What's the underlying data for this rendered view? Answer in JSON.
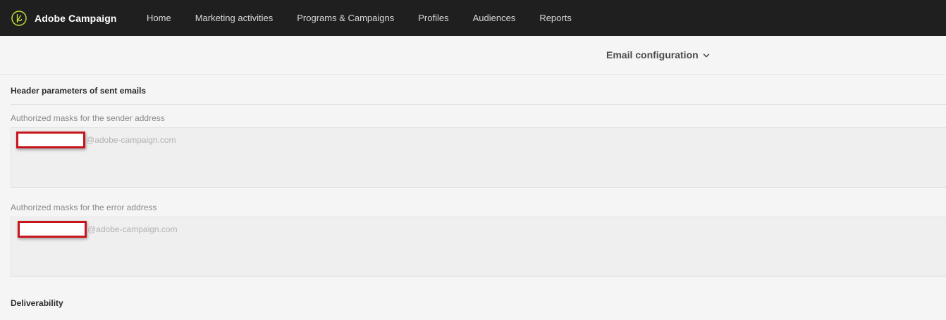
{
  "app": {
    "brand_name": "Adobe Campaign",
    "logo_icon": "adobe-campaign-logo-icon"
  },
  "nav": {
    "items": [
      {
        "label": "Home"
      },
      {
        "label": "Marketing activities"
      },
      {
        "label": "Programs & Campaigns"
      },
      {
        "label": "Profiles"
      },
      {
        "label": "Audiences"
      },
      {
        "label": "Reports"
      }
    ]
  },
  "subheader": {
    "title": "Email configuration",
    "dropdown_icon": "chevron-down-icon"
  },
  "sections": {
    "header_params": {
      "title": "Header parameters of sent emails",
      "sender": {
        "label": "Authorized masks for the sender address",
        "domain": "@adobe-campaign.com"
      },
      "error": {
        "label": "Authorized masks for the error address",
        "domain": "@adobe-campaign.com"
      }
    },
    "deliverability": {
      "title": "Deliverability"
    }
  },
  "colors": {
    "topbar": "#1f1f1f",
    "logo_accent": "#c7e23e",
    "highlight_border": "#c8151b",
    "page_bg": "#f5f5f5"
  }
}
